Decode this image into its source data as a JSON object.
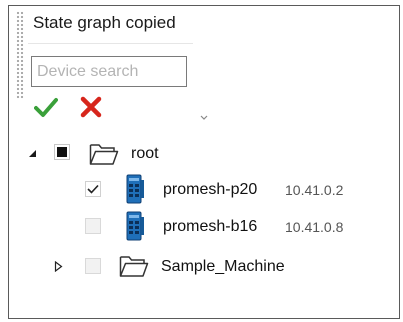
{
  "panel": {
    "status_text": "State graph copied",
    "search": {
      "placeholder": "Device search",
      "value": ""
    },
    "confirm_button": {
      "icon": "checkmark-icon",
      "color": "#3aa03a"
    },
    "cancel_button": {
      "icon": "close-x-icon",
      "color": "#d7261c"
    }
  },
  "tree": {
    "root": {
      "label": "root",
      "expanded": true,
      "check_state": "partial",
      "icon": "folder-open-icon",
      "children": [
        {
          "label": "promesh-p20",
          "ip": "10.41.0.2",
          "checked": true,
          "icon": "network-switch-icon"
        },
        {
          "label": "promesh-b16",
          "ip": "10.41.0.8",
          "checked": false,
          "icon": "network-switch-icon"
        },
        {
          "label": "Sample_Machine",
          "expanded": false,
          "checked": false,
          "icon": "folder-open-icon"
        }
      ]
    }
  }
}
